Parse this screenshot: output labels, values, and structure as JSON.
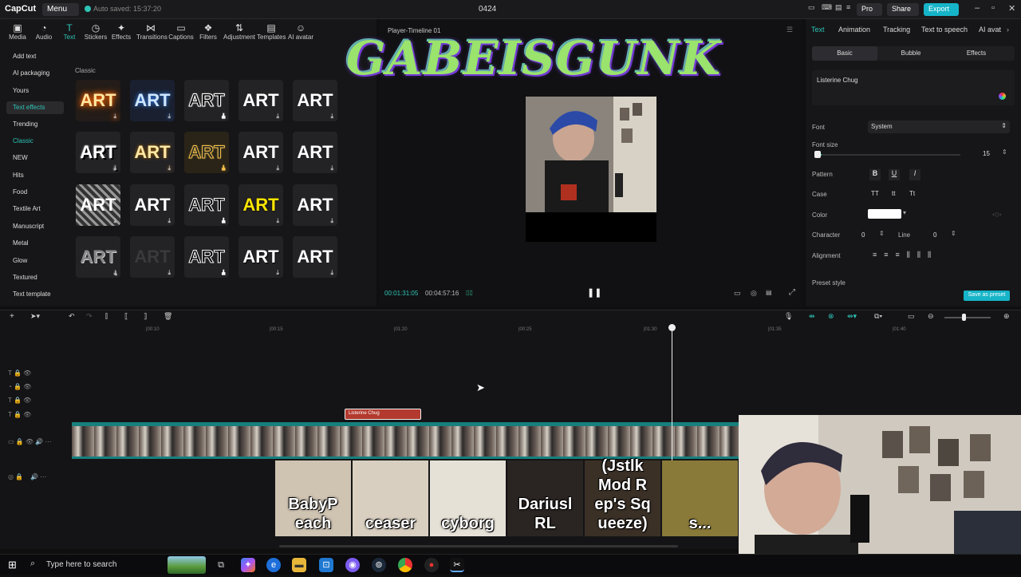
{
  "app": {
    "name": "CapCut",
    "menu": "Menu",
    "saved": "Auto saved: 15:37:20",
    "project": "0424",
    "pro": "Pro",
    "share": "Share",
    "export": "Export"
  },
  "toolbar": [
    {
      "label": "Media",
      "icon": "media-icon"
    },
    {
      "label": "Audio",
      "icon": "audio-icon"
    },
    {
      "label": "Text",
      "icon": "text-icon"
    },
    {
      "label": "Stickers",
      "icon": "stickers-icon"
    },
    {
      "label": "Effects",
      "icon": "effects-icon"
    },
    {
      "label": "Transitions",
      "icon": "transitions-icon"
    },
    {
      "label": "Captions",
      "icon": "captions-icon"
    },
    {
      "label": "Filters",
      "icon": "filters-icon"
    },
    {
      "label": "Adjustment",
      "icon": "adjustment-icon"
    },
    {
      "label": "Templates",
      "icon": "templates-icon"
    },
    {
      "label": "AI avatar",
      "icon": "ai-avatar-icon"
    }
  ],
  "categories": [
    "Add text",
    "AI packaging",
    "Yours",
    "Text effects",
    "Trending",
    "Classic",
    "NEW",
    "Hits",
    "Food",
    "Textile Art",
    "Manuscript",
    "Metal",
    "Glow",
    "Textured",
    "Text template"
  ],
  "section_label": "Classic",
  "thumb_text": "ART",
  "player": {
    "title": "Player-Timeline 01",
    "current_time": "00:01:31:05",
    "total_time": "00:04:57:16",
    "overlay_text": "GABEISGUNK"
  },
  "right": {
    "tabs": [
      "Text",
      "Animation",
      "Tracking",
      "Text to speech",
      "AI avat"
    ],
    "subtabs": [
      "Basic",
      "Bubble",
      "Effects"
    ],
    "text_value": "Listerine Chug",
    "font_label": "Font",
    "font_value": "System",
    "font_size_label": "Font size",
    "font_size_value": "15",
    "pattern_label": "Pattern",
    "case_label": "Case",
    "color_label": "Color",
    "character_label": "Character",
    "character_value": "0",
    "line_label": "Line",
    "line_value": "0",
    "alignment_label": "Alignment",
    "preset_label": "Preset style",
    "save_preset": "Save as preset"
  },
  "timeline": {
    "ticks": [
      "|00:10",
      "|00:15",
      "|01:20",
      "|00:25",
      "|01:30",
      "|01:35",
      "|01:40"
    ],
    "clip_label": "Listerine Chug"
  },
  "overlay_tiles": [
    "BabyP each",
    "ceaser",
    "cyborg",
    "Dariusl RL",
    "(Jstlk Mod R ep's Sq ueeze)",
    "s..."
  ],
  "taskbar": {
    "search_placeholder": "Type here to search"
  }
}
